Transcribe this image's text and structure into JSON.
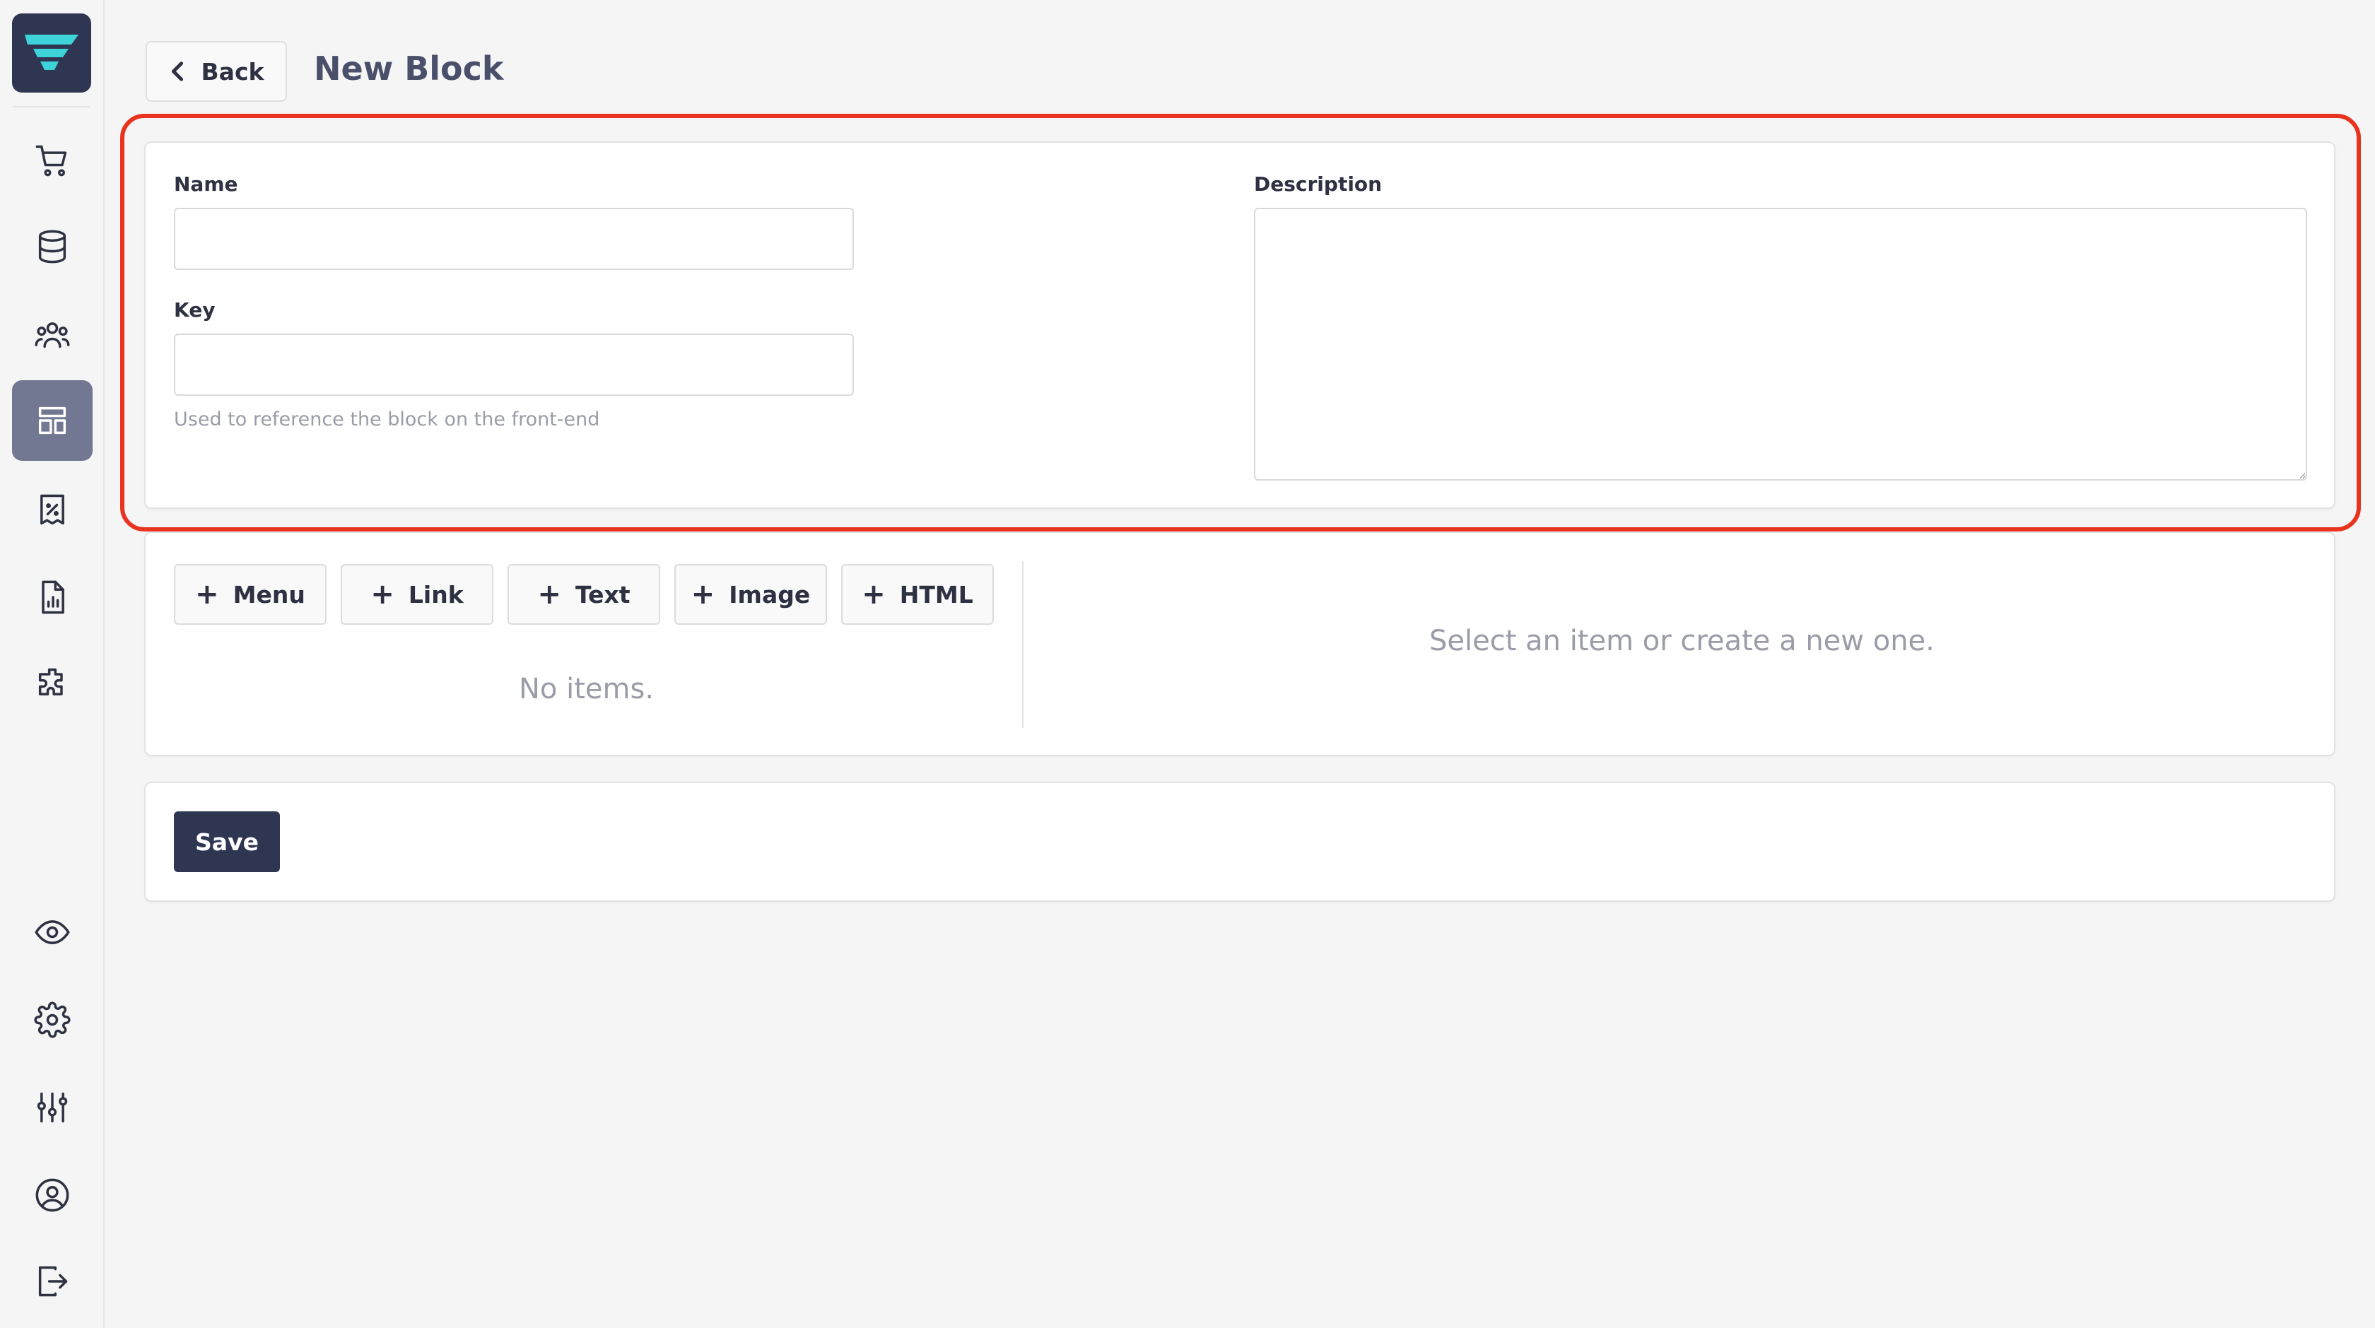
{
  "colors": {
    "brand": "#2f3652",
    "accent": "#3ed2d9",
    "active_nav": "#727892",
    "highlight": "#e8331e"
  },
  "sidebar": {
    "logo_icon": "brand-logo",
    "nav_top": [
      {
        "icon": "cart-icon",
        "active": false
      },
      {
        "icon": "database-icon",
        "active": false
      },
      {
        "icon": "users-icon",
        "active": false
      },
      {
        "icon": "layout-icon",
        "active": true
      },
      {
        "icon": "discount-receipt-icon",
        "active": false
      },
      {
        "icon": "report-icon",
        "active": false
      },
      {
        "icon": "puzzle-icon",
        "active": false
      }
    ],
    "nav_bottom": [
      {
        "icon": "eye-icon"
      },
      {
        "icon": "gear-icon"
      },
      {
        "icon": "sliders-icon"
      },
      {
        "icon": "user-circle-icon"
      },
      {
        "icon": "logout-icon"
      }
    ]
  },
  "header": {
    "back_label": "Back",
    "title": "New Block"
  },
  "form": {
    "name_label": "Name",
    "name_value": "",
    "key_label": "Key",
    "key_value": "",
    "key_help": "Used to reference the block on the front-end",
    "description_label": "Description",
    "description_value": ""
  },
  "items": {
    "add_buttons": [
      "Menu",
      "Link",
      "Text",
      "Image",
      "HTML"
    ],
    "empty_list": "No items.",
    "empty_detail": "Select an item or create a new one."
  },
  "footer": {
    "save_label": "Save"
  }
}
